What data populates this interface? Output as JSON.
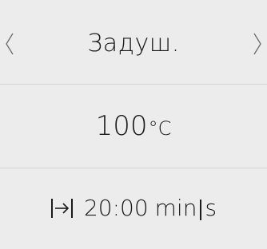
{
  "mode": {
    "label": "Задуш.",
    "prev_icon": "chevron-left-icon",
    "next_icon": "chevron-right-icon"
  },
  "temperature": {
    "value": "100",
    "unit": "°C"
  },
  "timer": {
    "icon": "duration-end-icon",
    "value": "20:00",
    "unit_primary": "min",
    "unit_secondary": "s"
  },
  "colors": {
    "background": "#ececec",
    "divider": "#d3d3d3",
    "text": "#1b1b1b"
  }
}
